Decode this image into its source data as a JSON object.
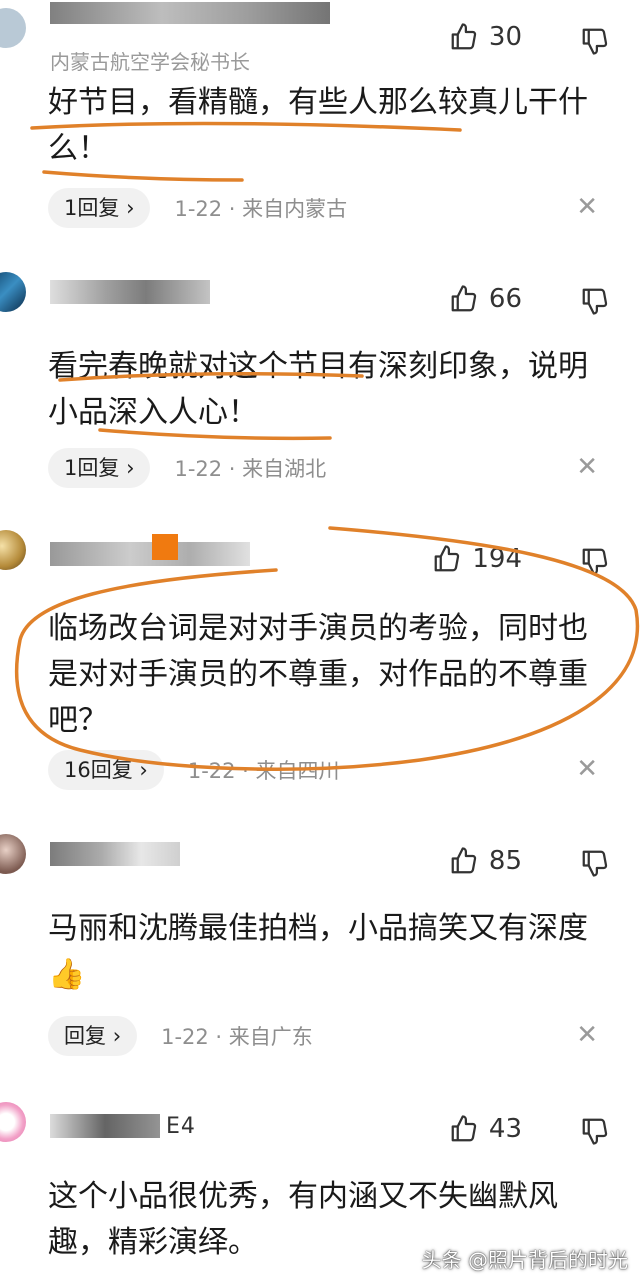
{
  "comments": [
    {
      "subtitle": "内蒙古航空学会秘书长",
      "likes": "30",
      "body": "好节目，看精髓，有些人那么较真儿干什么！",
      "reply": "1回复",
      "meta": "1-22 · 来自内蒙古"
    },
    {
      "likes": "66",
      "body": "看完春晚就对这个节目有深刻印象，说明小品深入人心！",
      "reply": "1回复",
      "meta": "1-22 · 来自湖北"
    },
    {
      "likes": "194",
      "body": "临场改台词是对对手演员的考验，同时也是对对手演员的不尊重，对作品的不尊重吧？",
      "reply": "16回复",
      "meta": "1-22 · 来自四川"
    },
    {
      "likes": "85",
      "body": "马丽和沈腾最佳拍档，小品搞笑又有深度👍",
      "reply": "回复",
      "meta": "1-22 · 来自广东"
    },
    {
      "author_fragment": "E4",
      "likes": "43",
      "body": "这个小品很优秀，有内涵又不失幽默风趣，精彩演绎。"
    }
  ],
  "watermark": "头条 @照片背后的时光",
  "colors": {
    "annotation": "#e0812a",
    "muted": "#8e8e8e"
  },
  "icons": {
    "like": "thumbs-up-icon",
    "dislike": "thumbs-down-icon",
    "close": "close-icon",
    "reply_arrow": "chevron-right-icon"
  }
}
